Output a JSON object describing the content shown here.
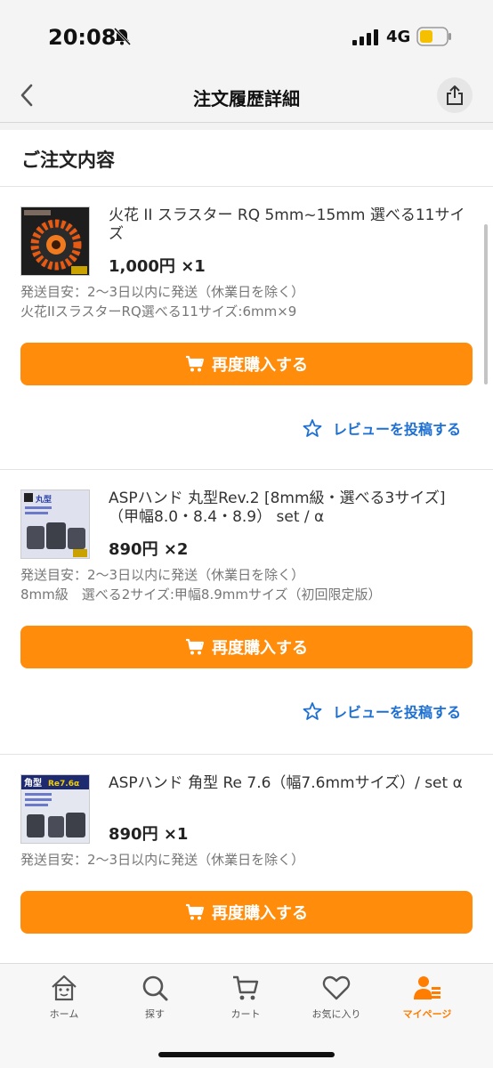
{
  "status_bar": {
    "time": "20:08",
    "network": "4G"
  },
  "nav": {
    "title": "注文履歴詳細"
  },
  "section": {
    "title": "ご注文内容"
  },
  "orders": [
    {
      "name": "火花 II スラスター RQ 5mm~15mm 選べる11サイズ",
      "price": "1,000円 ×1",
      "notes": [
        "発送目安：2〜3日以内に発送（休業日を除く）",
        "火花IIスラスターRQ選べる11サイズ:6mm×9"
      ],
      "rebuy_label": "再度購入する",
      "review_label": "レビューを投稿する"
    },
    {
      "name": "ASPハンド 丸型Rev.2 [8mm級・選べる3サイズ]（甲幅8.0・8.4・8.9） set / α",
      "price": "890円 ×2",
      "notes": [
        "発送目安：2〜3日以内に発送（休業日を除く）",
        "8mm級　選べる2サイズ:甲幅8.9mmサイズ（初回限定版）"
      ],
      "rebuy_label": "再度購入する",
      "review_label": "レビューを投稿する"
    },
    {
      "name": "ASPハンド 角型 Re 7.6（幅7.6mmサイズ）/ set α",
      "price": "890円 ×1",
      "notes": [
        "発送目安：2〜3日以内に発送（休業日を除く）"
      ],
      "rebuy_label": "再度購入する"
    }
  ],
  "tabs": [
    {
      "label": "ホーム",
      "icon": "home-icon"
    },
    {
      "label": "探す",
      "icon": "search-icon"
    },
    {
      "label": "カート",
      "icon": "cart-icon"
    },
    {
      "label": "お気に入り",
      "icon": "heart-icon"
    },
    {
      "label": "マイページ",
      "icon": "person-icon",
      "active": true
    }
  ],
  "colors": {
    "accent": "#ff8c0b",
    "link": "#1d6fd1",
    "active_tab": "#ff7d00"
  }
}
